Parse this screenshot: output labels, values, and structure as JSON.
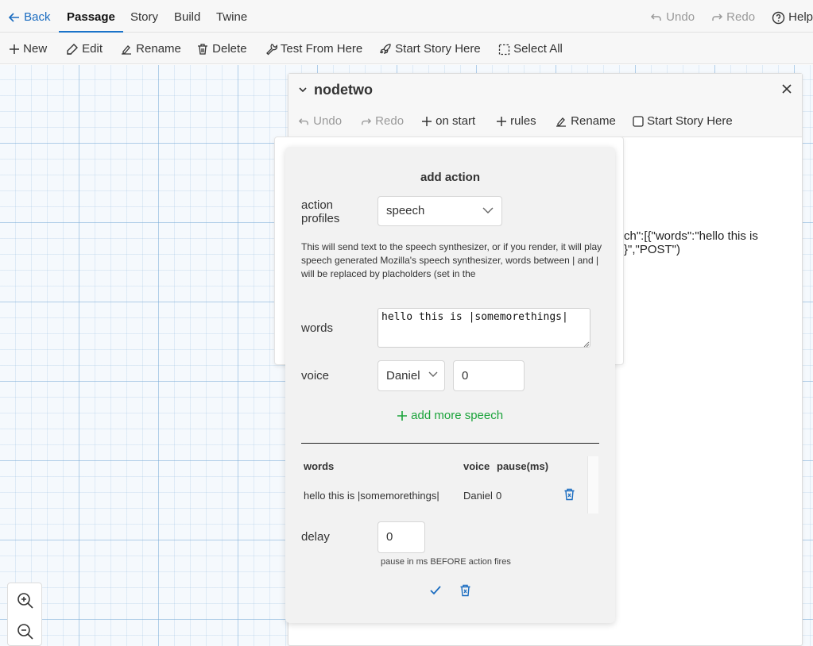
{
  "nav": {
    "back": "Back",
    "tabs": [
      "Passage",
      "Story",
      "Build",
      "Twine"
    ],
    "undo": "Undo",
    "redo": "Redo",
    "help": "Help"
  },
  "toolbar": {
    "new": "New",
    "edit": "Edit",
    "rename": "Rename",
    "delete": "Delete",
    "test_from_here": "Test From Here",
    "start_story_here": "Start Story Here",
    "select_all": "Select All"
  },
  "dialog": {
    "title": "nodetwo",
    "undo": "Undo",
    "redo": "Redo",
    "on_start": "on start",
    "rules": "rules",
    "rename": "Rename",
    "start_story_here": "Start Story Here",
    "body_line1": "ch\":[{\"words\":\"hello this is",
    "body_line2": "}\",\"POST\")"
  },
  "add_action": {
    "heading": "add action",
    "profiles_label_line1": "action",
    "profiles_label_line2": "profiles",
    "profile_value": "speech",
    "description": "This will send text to the speech synthesizer, or if you render, it will play speech generated Mozilla's speech synthesizer, words between | and | will be replaced by placholders (set in the",
    "words_label": "words",
    "words_value": "hello this is |somemorethings|",
    "voice_label": "voice",
    "voice_value": "Daniel",
    "pause_value": "0",
    "add_more": "add more speech",
    "table": {
      "headers": [
        "words",
        "voice",
        "pause(ms)"
      ],
      "rows": [
        {
          "words": "hello this is |somemorethings|",
          "voice": "Daniel",
          "pause": "0"
        }
      ]
    },
    "delay_label": "delay",
    "delay_value": "0",
    "delay_hint": "pause in ms BEFORE action fires"
  },
  "colors": {
    "accent_blue": "#1a6cc0",
    "green": "#1aa33a"
  }
}
